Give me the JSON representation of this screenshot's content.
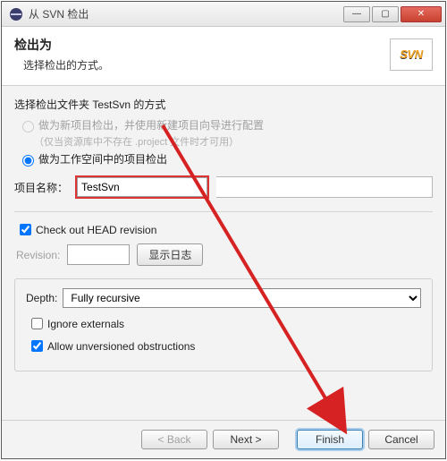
{
  "titlebar": {
    "title": "从 SVN 检出"
  },
  "banner": {
    "heading": "检出为",
    "subheading": "选择检出的方式。",
    "logo_text": "SVN"
  },
  "section": {
    "method_title": "选择检出文件夹 TestSvn 的方式",
    "radio1_label": "做为新项目检出，并使用新建项目向导进行配置",
    "radio1_hint": "（仅当资源库中不存在 .project 文件时才可用）",
    "radio2_label": "做为工作空间中的项目检出"
  },
  "name": {
    "label": "项目名称：",
    "value": "TestSvn"
  },
  "head": {
    "check_label": "Check out HEAD revision",
    "rev_label": "Revision:",
    "rev_value": "",
    "log_btn": "显示日志"
  },
  "depth": {
    "label": "Depth:",
    "value": "Fully recursive",
    "ignore_label": "Ignore externals",
    "allow_label": "Allow unversioned obstructions"
  },
  "footer": {
    "back": "< Back",
    "next": "Next >",
    "finish": "Finish",
    "cancel": "Cancel"
  }
}
